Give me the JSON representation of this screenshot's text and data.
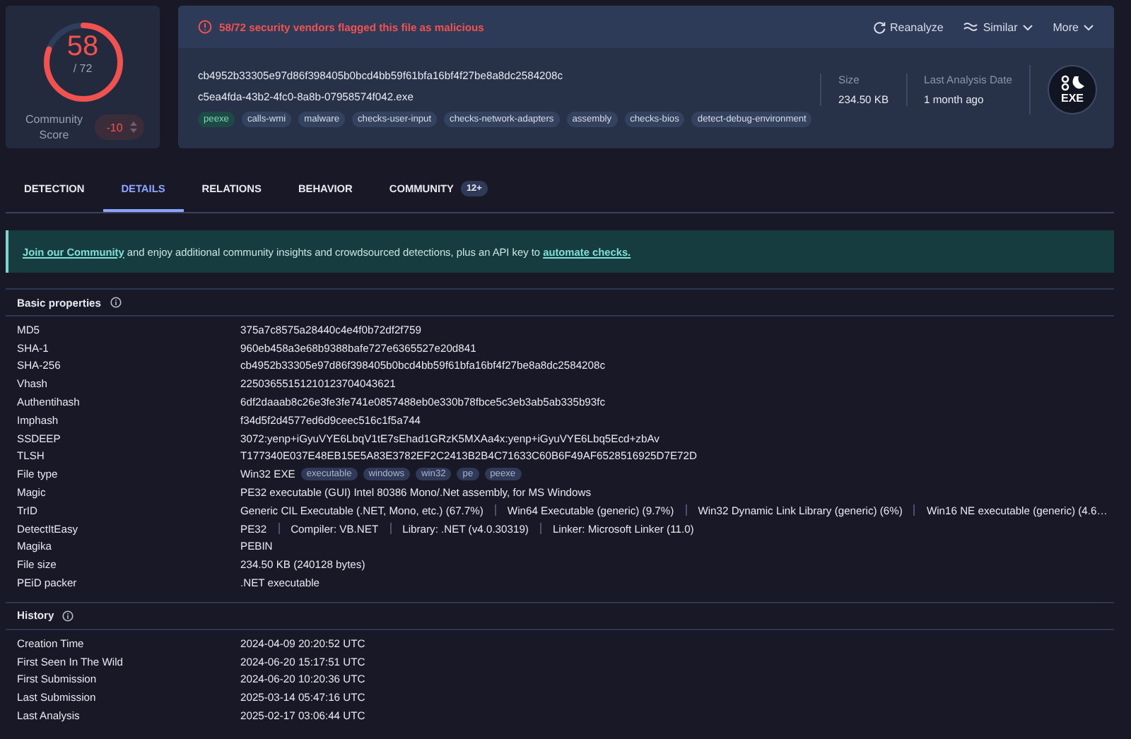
{
  "score": {
    "detections": "58",
    "total": "/ 72",
    "level": 0.806,
    "community_label": "Community Score",
    "community_value": "-10"
  },
  "header": {
    "alert": "58/72 security vendors flagged this file as malicious",
    "actions": [
      {
        "label": "Reanalyze",
        "kind": "reanalyze"
      },
      {
        "label": "Similar",
        "kind": "similar"
      },
      {
        "label": "More",
        "kind": "more"
      }
    ],
    "hash": "cb4952b33305e97d86f398405b0bcd4bb59f61bfa16bf4f27be8a8dc2584208c",
    "filename": "c5ea4fda-43b2-4fc0-8a8b-07958574f042.exe",
    "tags": [
      {
        "label": "peexe",
        "highlighted": true
      },
      {
        "label": "calls-wmi",
        "highlighted": false
      },
      {
        "label": "malware",
        "highlighted": false
      },
      {
        "label": "checks-user-input",
        "highlighted": false
      },
      {
        "label": "checks-network-adapters",
        "highlighted": false
      },
      {
        "label": "assembly",
        "highlighted": false
      },
      {
        "label": "checks-bios",
        "highlighted": false
      },
      {
        "label": "detect-debug-environment",
        "highlighted": false
      }
    ],
    "stats": [
      {
        "label": "Size",
        "value": "234.50 KB"
      },
      {
        "label": "Last Analysis Date",
        "value": "1 month ago"
      }
    ],
    "file_badge": "EXE"
  },
  "tabs": [
    {
      "label": "DETECTION",
      "selected": false
    },
    {
      "label": "DETAILS",
      "selected": true
    },
    {
      "label": "RELATIONS",
      "selected": false
    },
    {
      "label": "BEHAVIOR",
      "selected": false
    },
    {
      "label": "COMMUNITY",
      "selected": false,
      "badge": "12+"
    }
  ],
  "banner": [
    {
      "text": "Join our Community",
      "link": true
    },
    {
      "text": " and enjoy additional community insights and crowdsourced detections, plus an API key to ",
      "link": false
    },
    {
      "text": "automate checks.",
      "link": true
    }
  ],
  "sections": [
    {
      "title": "Basic properties",
      "rows": [
        {
          "label": "MD5",
          "kind": "text",
          "value": "375a7c8575a28440c4e4f0b72df2f759"
        },
        {
          "label": "SHA-1",
          "kind": "text",
          "value": "960eb458a3e68b9388bafe727e6365527e20d841"
        },
        {
          "label": "SHA-256",
          "kind": "text",
          "value": "cb4952b33305e97d86f398405b0bcd4bb59f61bfa16bf4f27be8a8dc2584208c"
        },
        {
          "label": "Vhash",
          "kind": "text",
          "value": "22503655151210123704043621"
        },
        {
          "label": "Authentihash",
          "kind": "text",
          "value": "6df2daaab8c26e3fe3fe741e0857488eb0e330b78fbce5c3eb3ab5ab335b93fc"
        },
        {
          "label": "Imphash",
          "kind": "text",
          "value": "f34d5f2d4577ed6d9ceec516c1f5a744"
        },
        {
          "label": "SSDEEP",
          "kind": "text",
          "value": "3072:yenp+iGyuVYE6LbqV1tE7sEhad1GRzK5MXAa4x:yenp+iGyuVYE6Lbq5Ecd+zbAv"
        },
        {
          "label": "TLSH",
          "kind": "text",
          "value": "T177340E037E48EB15E5A83E3782EF2C2413B2B4C71633C60B6F49AF6528516925D7E72D"
        },
        {
          "label": "File type",
          "kind": "tags",
          "value": "Win32 EXE",
          "tags": [
            "executable",
            "windows",
            "win32",
            "pe",
            "peexe"
          ]
        },
        {
          "label": "Magic",
          "kind": "text",
          "value": "PE32 executable (GUI) Intel 80386 Mono/.Net assembly, for MS Windows"
        },
        {
          "label": "TrID",
          "kind": "segments",
          "parts": [
            "Generic CIL Executable (.NET, Mono, etc.) (67.7%)",
            "Win64 Executable (generic) (9.7%)",
            "Win32 Dynamic Link Library (generic) (6%)",
            "Win16 NE executable (generic) (4.6…"
          ]
        },
        {
          "label": "DetectItEasy",
          "kind": "segments",
          "parts": [
            "PE32",
            "Compiler: VB.NET",
            "Library: .NET (v4.0.30319)",
            "Linker: Microsoft Linker (11.0)"
          ]
        },
        {
          "label": "Magika",
          "kind": "text",
          "value": "PEBIN"
        },
        {
          "label": "File size",
          "kind": "text",
          "value": "234.50 KB (240128 bytes)"
        },
        {
          "label": "PEiD packer",
          "kind": "text",
          "value": ".NET executable"
        }
      ]
    },
    {
      "title": "History",
      "rows": [
        {
          "label": "Creation Time",
          "kind": "text",
          "value": "2024-04-09 20:20:52 UTC"
        },
        {
          "label": "First Seen In The Wild",
          "kind": "text",
          "value": "2024-06-20 15:17:51 UTC"
        },
        {
          "label": "First Submission",
          "kind": "text",
          "value": "2024-06-20 10:20:36 UTC"
        },
        {
          "label": "Last Submission",
          "kind": "text",
          "value": "2025-03-14 05:47:16 UTC"
        },
        {
          "label": "Last Analysis",
          "kind": "text",
          "value": "2025-02-17 03:06:44 UTC"
        }
      ]
    }
  ]
}
